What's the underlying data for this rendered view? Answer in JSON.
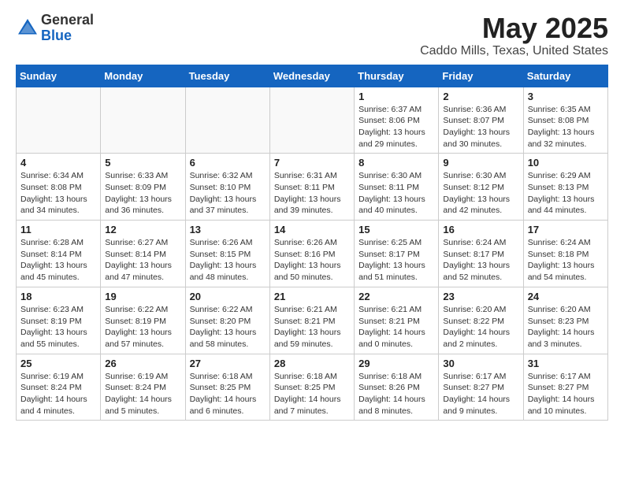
{
  "header": {
    "logo_general": "General",
    "logo_blue": "Blue",
    "month_title": "May 2025",
    "location": "Caddo Mills, Texas, United States"
  },
  "weekdays": [
    "Sunday",
    "Monday",
    "Tuesday",
    "Wednesday",
    "Thursday",
    "Friday",
    "Saturday"
  ],
  "weeks": [
    [
      {
        "day": "",
        "info": ""
      },
      {
        "day": "",
        "info": ""
      },
      {
        "day": "",
        "info": ""
      },
      {
        "day": "",
        "info": ""
      },
      {
        "day": "1",
        "info": "Sunrise: 6:37 AM\nSunset: 8:06 PM\nDaylight: 13 hours\nand 29 minutes."
      },
      {
        "day": "2",
        "info": "Sunrise: 6:36 AM\nSunset: 8:07 PM\nDaylight: 13 hours\nand 30 minutes."
      },
      {
        "day": "3",
        "info": "Sunrise: 6:35 AM\nSunset: 8:08 PM\nDaylight: 13 hours\nand 32 minutes."
      }
    ],
    [
      {
        "day": "4",
        "info": "Sunrise: 6:34 AM\nSunset: 8:08 PM\nDaylight: 13 hours\nand 34 minutes."
      },
      {
        "day": "5",
        "info": "Sunrise: 6:33 AM\nSunset: 8:09 PM\nDaylight: 13 hours\nand 36 minutes."
      },
      {
        "day": "6",
        "info": "Sunrise: 6:32 AM\nSunset: 8:10 PM\nDaylight: 13 hours\nand 37 minutes."
      },
      {
        "day": "7",
        "info": "Sunrise: 6:31 AM\nSunset: 8:11 PM\nDaylight: 13 hours\nand 39 minutes."
      },
      {
        "day": "8",
        "info": "Sunrise: 6:30 AM\nSunset: 8:11 PM\nDaylight: 13 hours\nand 40 minutes."
      },
      {
        "day": "9",
        "info": "Sunrise: 6:30 AM\nSunset: 8:12 PM\nDaylight: 13 hours\nand 42 minutes."
      },
      {
        "day": "10",
        "info": "Sunrise: 6:29 AM\nSunset: 8:13 PM\nDaylight: 13 hours\nand 44 minutes."
      }
    ],
    [
      {
        "day": "11",
        "info": "Sunrise: 6:28 AM\nSunset: 8:14 PM\nDaylight: 13 hours\nand 45 minutes."
      },
      {
        "day": "12",
        "info": "Sunrise: 6:27 AM\nSunset: 8:14 PM\nDaylight: 13 hours\nand 47 minutes."
      },
      {
        "day": "13",
        "info": "Sunrise: 6:26 AM\nSunset: 8:15 PM\nDaylight: 13 hours\nand 48 minutes."
      },
      {
        "day": "14",
        "info": "Sunrise: 6:26 AM\nSunset: 8:16 PM\nDaylight: 13 hours\nand 50 minutes."
      },
      {
        "day": "15",
        "info": "Sunrise: 6:25 AM\nSunset: 8:17 PM\nDaylight: 13 hours\nand 51 minutes."
      },
      {
        "day": "16",
        "info": "Sunrise: 6:24 AM\nSunset: 8:17 PM\nDaylight: 13 hours\nand 52 minutes."
      },
      {
        "day": "17",
        "info": "Sunrise: 6:24 AM\nSunset: 8:18 PM\nDaylight: 13 hours\nand 54 minutes."
      }
    ],
    [
      {
        "day": "18",
        "info": "Sunrise: 6:23 AM\nSunset: 8:19 PM\nDaylight: 13 hours\nand 55 minutes."
      },
      {
        "day": "19",
        "info": "Sunrise: 6:22 AM\nSunset: 8:19 PM\nDaylight: 13 hours\nand 57 minutes."
      },
      {
        "day": "20",
        "info": "Sunrise: 6:22 AM\nSunset: 8:20 PM\nDaylight: 13 hours\nand 58 minutes."
      },
      {
        "day": "21",
        "info": "Sunrise: 6:21 AM\nSunset: 8:21 PM\nDaylight: 13 hours\nand 59 minutes."
      },
      {
        "day": "22",
        "info": "Sunrise: 6:21 AM\nSunset: 8:21 PM\nDaylight: 14 hours\nand 0 minutes."
      },
      {
        "day": "23",
        "info": "Sunrise: 6:20 AM\nSunset: 8:22 PM\nDaylight: 14 hours\nand 2 minutes."
      },
      {
        "day": "24",
        "info": "Sunrise: 6:20 AM\nSunset: 8:23 PM\nDaylight: 14 hours\nand 3 minutes."
      }
    ],
    [
      {
        "day": "25",
        "info": "Sunrise: 6:19 AM\nSunset: 8:24 PM\nDaylight: 14 hours\nand 4 minutes."
      },
      {
        "day": "26",
        "info": "Sunrise: 6:19 AM\nSunset: 8:24 PM\nDaylight: 14 hours\nand 5 minutes."
      },
      {
        "day": "27",
        "info": "Sunrise: 6:18 AM\nSunset: 8:25 PM\nDaylight: 14 hours\nand 6 minutes."
      },
      {
        "day": "28",
        "info": "Sunrise: 6:18 AM\nSunset: 8:25 PM\nDaylight: 14 hours\nand 7 minutes."
      },
      {
        "day": "29",
        "info": "Sunrise: 6:18 AM\nSunset: 8:26 PM\nDaylight: 14 hours\nand 8 minutes."
      },
      {
        "day": "30",
        "info": "Sunrise: 6:17 AM\nSunset: 8:27 PM\nDaylight: 14 hours\nand 9 minutes."
      },
      {
        "day": "31",
        "info": "Sunrise: 6:17 AM\nSunset: 8:27 PM\nDaylight: 14 hours\nand 10 minutes."
      }
    ]
  ]
}
